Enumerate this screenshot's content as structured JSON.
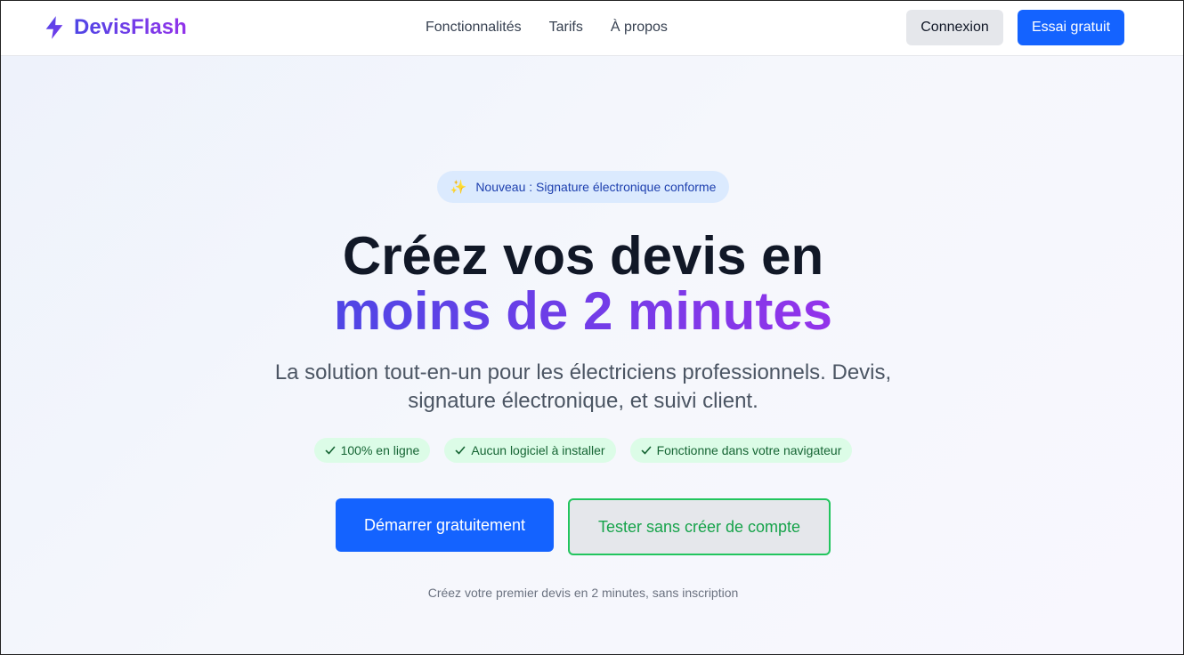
{
  "brand": {
    "name": "DevisFlash",
    "icon": "lightning-bolt-icon",
    "gradient_start": "#4f46e5",
    "gradient_end": "#9333ea"
  },
  "nav": {
    "links": [
      "Fonctionnalités",
      "Tarifs",
      "À propos"
    ],
    "login_label": "Connexion",
    "trial_label": "Essai gratuit"
  },
  "hero": {
    "badge_icon": "sparkles-icon",
    "badge_glyph": "✨",
    "badge_text": "Nouveau : Signature électronique conforme",
    "headline_line1": "Créez vos devis en",
    "headline_line2": "moins de 2 minutes",
    "subtitle": "La solution tout-en-un pour les électriciens professionnels. Devis, signature électronique, et suivi client.",
    "features": [
      "100% en ligne",
      "Aucun logiciel à installer",
      "Fonctionne dans votre navigateur"
    ],
    "primary_cta": "Démarrer gratuitement",
    "secondary_cta": "Tester sans créer de compte",
    "note": "Créez votre premier devis en 2 minutes, sans inscription"
  },
  "colors": {
    "primary_blue": "#1463ff",
    "feature_green_bg": "#dcfce7",
    "feature_green_text": "#166534",
    "demo_border": "#22c55e",
    "badge_bg": "#dbeafe"
  }
}
